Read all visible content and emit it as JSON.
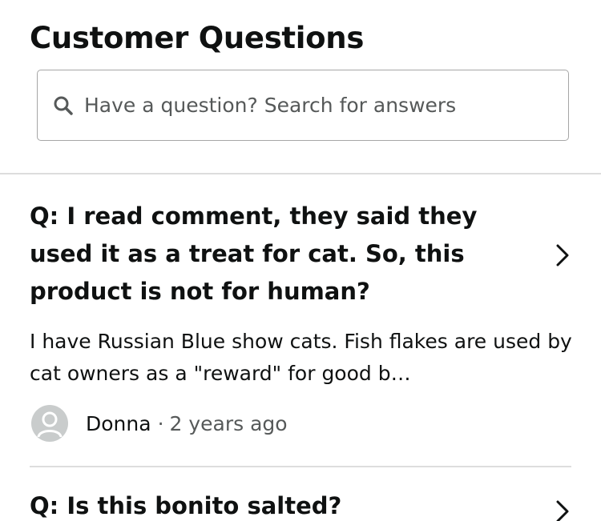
{
  "header": {
    "title": "Customer Questions"
  },
  "search": {
    "placeholder": "Have a question? Search for answers",
    "icon": "search-icon"
  },
  "questions": [
    {
      "question": "Q: I read comment, they said they used it as a treat for cat. So, this product is not for human?",
      "answer": "I have Russian Blue show cats. Fish flakes are used by cat owners as a \"reward\" for good b…",
      "author": "Donna",
      "separator": "·",
      "time": "2 years ago"
    },
    {
      "question": "Q: Is this bonito salted?"
    }
  ],
  "colors": {
    "text": "#0f1111",
    "muted": "#565959",
    "border": "#a6a6a6",
    "divider": "#dddddd",
    "avatar": "#c9cccc"
  }
}
